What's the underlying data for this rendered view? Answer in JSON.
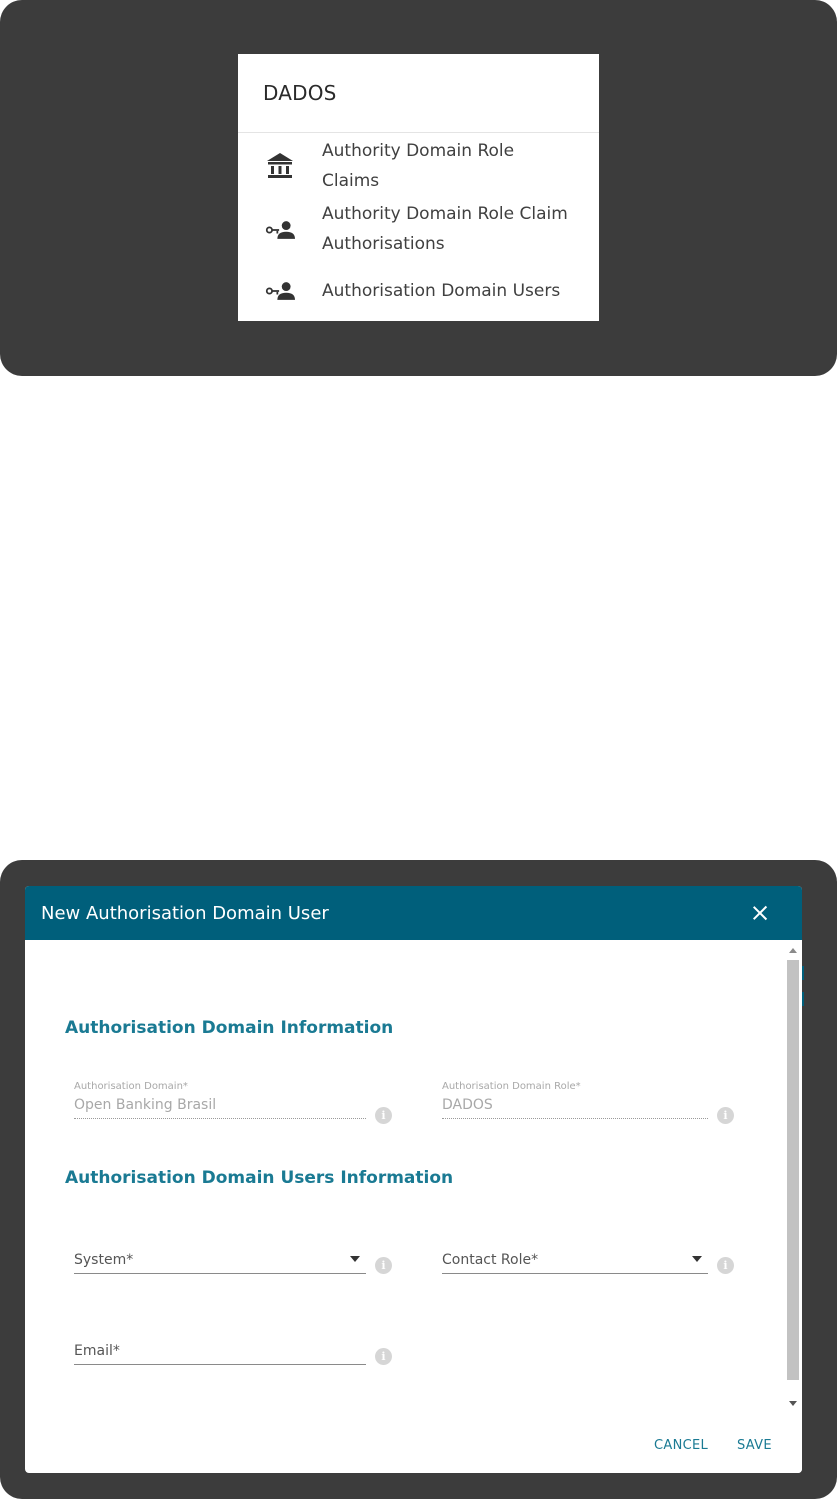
{
  "menu": {
    "header": "DADOS",
    "items": [
      {
        "icon": "bank-icon",
        "line1": "Authority Domain Role",
        "line2": "Claims"
      },
      {
        "icon": "key-person-icon",
        "line1": "Authority Domain Role Claim",
        "line2": "Authorisations"
      },
      {
        "icon": "key-person-icon",
        "line1": "Authorisation Domain Users",
        "line2": ""
      }
    ]
  },
  "dialog": {
    "title": "New Authorisation Domain User",
    "section1_title": "Authorisation Domain Information",
    "section2_title": "Authorisation Domain Users Information",
    "fields": {
      "auth_domain": {
        "label": "Authorisation Domain*",
        "value": "Open Banking Brasil"
      },
      "auth_domain_role": {
        "label": "Authorisation Domain Role*",
        "value": "DADOS"
      },
      "system": {
        "placeholder": "System*"
      },
      "contact_role": {
        "placeholder": "Contact Role*"
      },
      "email": {
        "placeholder": "Email*"
      }
    },
    "info_glyph": "i",
    "cancel_label": "CANCEL",
    "save_label": "SAVE"
  },
  "colors": {
    "header_bg": "#005f7b",
    "accent_text": "#1a7a93",
    "frame_bg": "#3c3c3c"
  }
}
